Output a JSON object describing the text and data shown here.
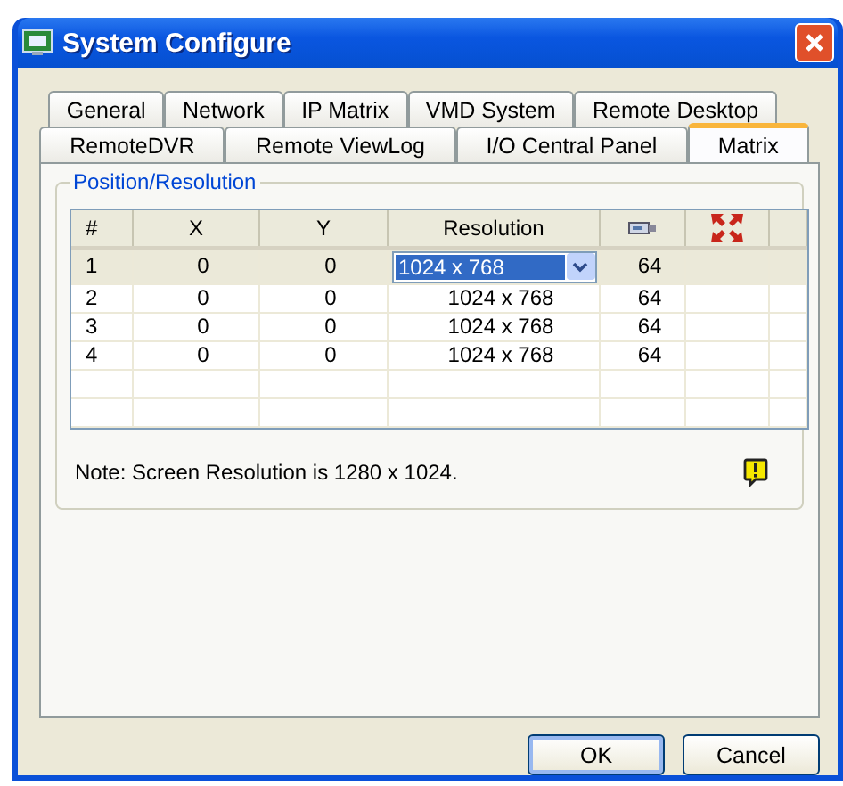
{
  "window": {
    "title": "System Configure"
  },
  "tab_rows": [
    [
      {
        "label": "General",
        "selected": false
      },
      {
        "label": "Network",
        "selected": false
      },
      {
        "label": "IP Matrix",
        "selected": false
      },
      {
        "label": "VMD System",
        "selected": false
      },
      {
        "label": "Remote Desktop",
        "selected": false
      }
    ],
    [
      {
        "label": "RemoteDVR",
        "selected": false
      },
      {
        "label": "Remote ViewLog",
        "selected": false
      },
      {
        "label": "I/O Central Panel",
        "selected": false
      },
      {
        "label": "Matrix",
        "selected": true
      }
    ]
  ],
  "group": {
    "title": "Position/Resolution"
  },
  "table": {
    "columns": [
      "#",
      "X",
      "Y",
      "Resolution"
    ],
    "rows": [
      {
        "cells": [
          "1",
          "0",
          "0",
          "1024 x 768",
          "64"
        ],
        "selected": true,
        "kind": "dropdown"
      },
      {
        "cells": [
          "2",
          "0",
          "0",
          "1024 x 768",
          "64"
        ],
        "selected": false,
        "kind": "text"
      },
      {
        "cells": [
          "3",
          "0",
          "0",
          "1024 x 768",
          "64"
        ],
        "selected": false,
        "kind": "text"
      },
      {
        "cells": [
          "4",
          "0",
          "0",
          "1024 x 768",
          "64"
        ],
        "selected": false,
        "kind": "text"
      }
    ]
  },
  "note": "Note: Screen Resolution is 1280 x 1024.",
  "buttons": [
    "OK",
    "Cancel"
  ]
}
